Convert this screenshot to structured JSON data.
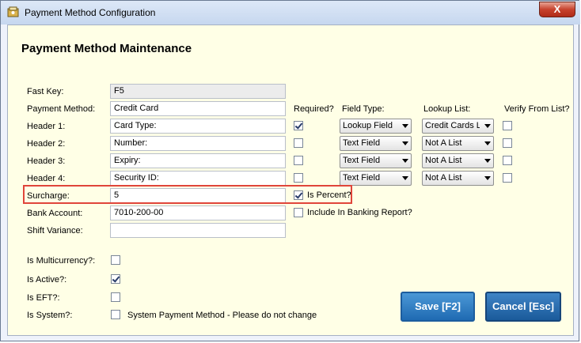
{
  "window": {
    "title": "Payment Method Configuration",
    "close_label": "X"
  },
  "heading": "Payment Method Maintenance",
  "labels": {
    "fast_key": "Fast Key:",
    "payment_method": "Payment Method:",
    "header1": "Header 1:",
    "header2": "Header 2:",
    "header3": "Header 3:",
    "header4": "Header 4:",
    "surcharge": "Surcharge:",
    "bank_account": "Bank Account:",
    "shift_variance": "Shift Variance:",
    "is_multicurrency": "Is Multicurrency?:",
    "is_active": "Is Active?:",
    "is_eft": "Is EFT?:",
    "is_system": "Is System?:"
  },
  "columns": {
    "required": "Required?",
    "field_type": "Field Type:",
    "lookup_list": "Lookup List:",
    "verify": "Verify From List?"
  },
  "values": {
    "fast_key": "F5",
    "payment_method": "Credit Card",
    "header1": "Card Type:",
    "header2": "Number:",
    "header3": "Expiry:",
    "header4": "Security ID:",
    "surcharge": "5",
    "bank_account": "7010-200-00",
    "shift_variance": ""
  },
  "header_rows": [
    {
      "required": true,
      "field_type": "Lookup Field",
      "lookup_list": "Credit Cards L",
      "verify": false
    },
    {
      "required": false,
      "field_type": "Text Field",
      "lookup_list": "Not A List",
      "verify": false
    },
    {
      "required": false,
      "field_type": "Text Field",
      "lookup_list": "Not A List",
      "verify": false
    },
    {
      "required": false,
      "field_type": "Text Field",
      "lookup_list": "Not A List",
      "verify": false
    }
  ],
  "options": {
    "is_percent_label": "Is Percent?",
    "is_percent": true,
    "include_banking_label": "Include In Banking Report?",
    "include_banking": false,
    "system_note": "System Payment Method - Please do not change"
  },
  "flags": {
    "is_multicurrency": false,
    "is_active": true,
    "is_eft": false,
    "is_system": false
  },
  "buttons": {
    "save": "Save [F2]",
    "cancel": "Cancel [Esc]"
  },
  "colors": {
    "client_bg": "#ffffe6",
    "highlight": "#e0453a",
    "button": "#2a79c0"
  }
}
